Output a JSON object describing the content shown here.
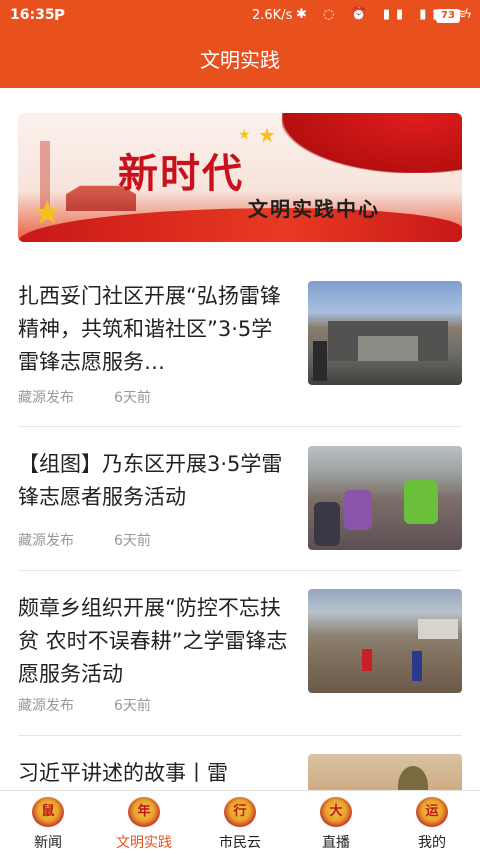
{
  "status": {
    "time": "16:35",
    "app_icon": "P",
    "net_rate": "2.6K/s",
    "icons_text": "✱ ◌ ⏰ ▮▮ ▮▮ ≋",
    "battery": "73",
    "charging": "ϟ"
  },
  "header": {
    "title": "文明实践"
  },
  "banner": {
    "headline": "新时代",
    "subline": "文明实践中心"
  },
  "news": [
    {
      "title": "扎西妥门社区开展“弘扬雷锋精神，共筑和谐社区”3·5学雷锋志愿服务…",
      "source": "藏源发布",
      "time": "6天前"
    },
    {
      "title": "【组图】乃东区开展3·5学雷锋志愿者服务活动",
      "source": "藏源发布",
      "time": "6天前"
    },
    {
      "title": "颇章乡组织开展“防控不忘扶贫 农时不误春耕”之学雷锋志愿服务活动",
      "source": "藏源发布",
      "time": "6天前"
    },
    {
      "title": "习近平讲述的故事丨雷",
      "source": "",
      "time": ""
    }
  ],
  "tabs": [
    {
      "label": "新闻",
      "badge": "鼠"
    },
    {
      "label": "文明实践",
      "badge": "年"
    },
    {
      "label": "市民云",
      "badge": "行"
    },
    {
      "label": "直播",
      "badge": "大"
    },
    {
      "label": "我的",
      "badge": "运"
    }
  ],
  "colors": {
    "brand": "#e8501e",
    "text": "#222222",
    "meta": "#999999"
  }
}
